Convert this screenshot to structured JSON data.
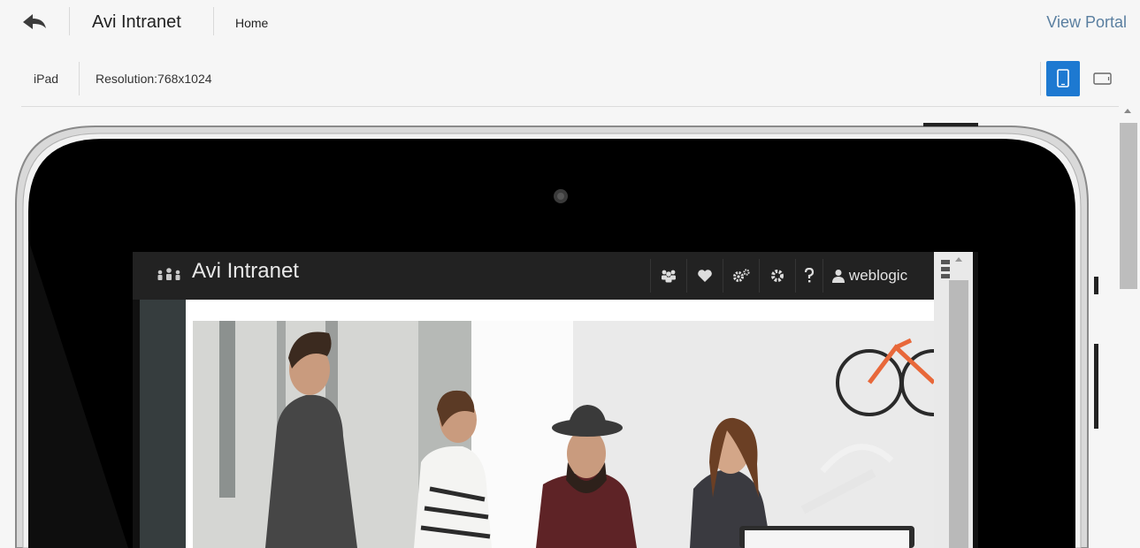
{
  "header": {
    "app_title": "Avi Intranet",
    "breadcrumb": "Home",
    "view_portal": "View Portal"
  },
  "device_bar": {
    "device": "iPad",
    "resolution": "Resolution:768x1024",
    "orientation_selected": "portrait"
  },
  "preview": {
    "portal_title": "Avi Intranet",
    "user": "weblogic",
    "toolbar_icons": [
      "people-icon",
      "heart-icon",
      "gears-icon",
      "settings-icon",
      "help-icon",
      "user-icon"
    ]
  },
  "colors": {
    "accent": "#1d79d1",
    "link": "#5a7fa0",
    "device_frame": "#000000",
    "portal_header": "#222222",
    "portal_sidebar": "#363d3e"
  }
}
